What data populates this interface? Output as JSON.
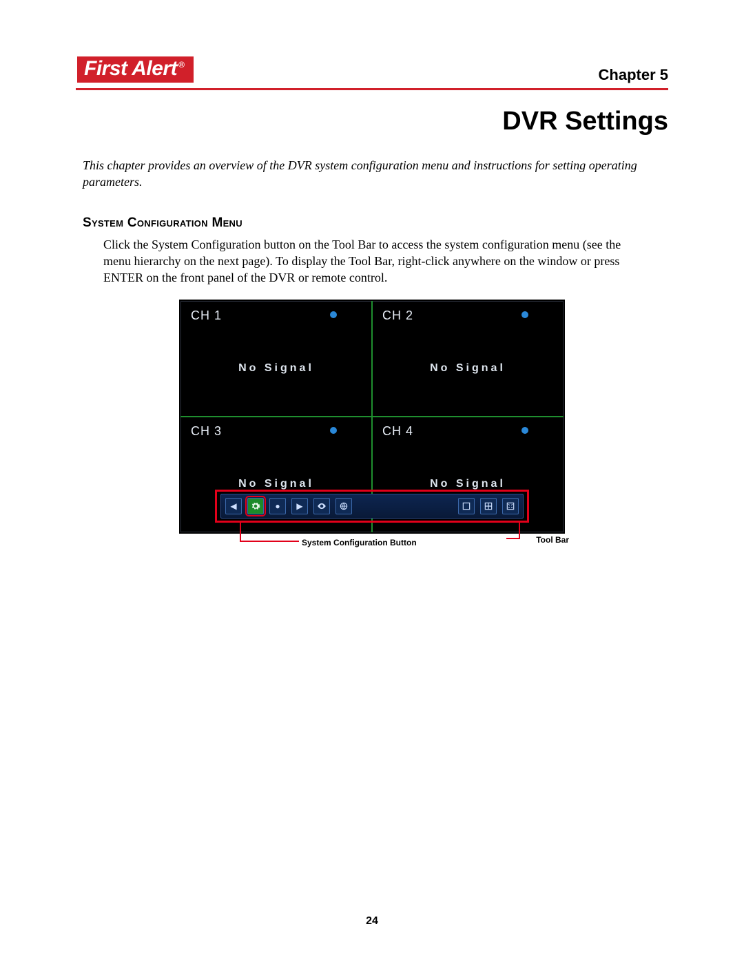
{
  "header": {
    "logo_text": "First Alert",
    "chapter_label": "Chapter 5"
  },
  "title": "DVR Settings",
  "intro": "This chapter provides an overview of the DVR system configuration menu and instructions for setting operating parameters.",
  "section": {
    "heading": "System Configuration Menu",
    "body": "Click the System Configuration button on the Tool Bar to access the system configuration menu (see the menu hierarchy on the next page). To display the Tool Bar, right-click anywhere on the window or press ENTER on the front panel of the DVR or remote control."
  },
  "dvr": {
    "channels": [
      {
        "label": "CH 1",
        "status": "No Signal"
      },
      {
        "label": "CH 2",
        "status": "No Signal"
      },
      {
        "label": "CH 3",
        "status": "No Signal"
      },
      {
        "label": "CH 4",
        "status": "No Signal"
      }
    ]
  },
  "callouts": {
    "config_button": "System Configuration Button",
    "toolbar": "Tool Bar"
  },
  "page_number": "24",
  "colors": {
    "brand_red": "#d1202a",
    "callout_red": "#e2001a",
    "divider_green": "#1f8f2f",
    "rec_dot": "#2a88d8"
  }
}
